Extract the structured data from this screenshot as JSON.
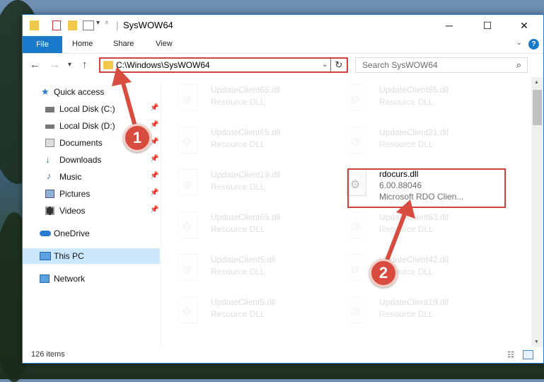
{
  "window": {
    "title": "SysWOW64"
  },
  "ribbon": {
    "tabs": [
      "File",
      "Home",
      "Share",
      "View"
    ],
    "help": "?"
  },
  "address": {
    "path": "C:\\Windows\\SysWOW64"
  },
  "search": {
    "placeholder": "Search SysWOW64"
  },
  "sidebar": {
    "items": [
      {
        "label": "Quick access",
        "icon": "star-icon"
      },
      {
        "label": "Local Disk (C:)",
        "icon": "drive-icon"
      },
      {
        "label": "Local Disk (D:)",
        "icon": "drive-icon"
      },
      {
        "label": "Documents",
        "icon": "documents-icon"
      },
      {
        "label": "Downloads",
        "icon": "download-icon"
      },
      {
        "label": "Music",
        "icon": "music-icon"
      },
      {
        "label": "Pictures",
        "icon": "pictures-icon"
      },
      {
        "label": "Videos",
        "icon": "videos-icon"
      },
      {
        "label": "OneDrive",
        "icon": "cloud-icon"
      },
      {
        "label": "This PC",
        "icon": "computer-icon"
      },
      {
        "label": "Network",
        "icon": "network-icon"
      }
    ]
  },
  "files": [
    {
      "name": "UpdateClient65.dll",
      "desc": "Resource DLL"
    },
    {
      "name": "UpdateClient65.dll",
      "desc": "Resource DLL"
    },
    {
      "name": "UpdateClient65.dll",
      "desc": "Resource DLL"
    },
    {
      "name": "UpdateClient21.dll",
      "desc": "Resource DLL"
    },
    {
      "name": "UpdateClient19.dll",
      "desc": "Resource DLL"
    },
    {
      "name": "rdocurs.dll",
      "version": "6.00.88046",
      "desc": "Microsoft RDO Clien..."
    },
    {
      "name": "UpdateClient65.dll",
      "desc": "Resource DLL"
    },
    {
      "name": "UpdateClient63.dll",
      "desc": "Resource DLL"
    },
    {
      "name": "UpdateClient5.dll",
      "desc": "Resource DLL"
    },
    {
      "name": "UpdateClient42.dll",
      "desc": "Resource DLL"
    },
    {
      "name": "UpdateClient5.dll",
      "desc": "Resource DLL"
    },
    {
      "name": "UpdateClient19.dll",
      "desc": "Resource DLL"
    }
  ],
  "status": {
    "count": "126 items"
  },
  "annotations": {
    "step1": "1",
    "step2": "2",
    "color": "#d84c3f"
  }
}
